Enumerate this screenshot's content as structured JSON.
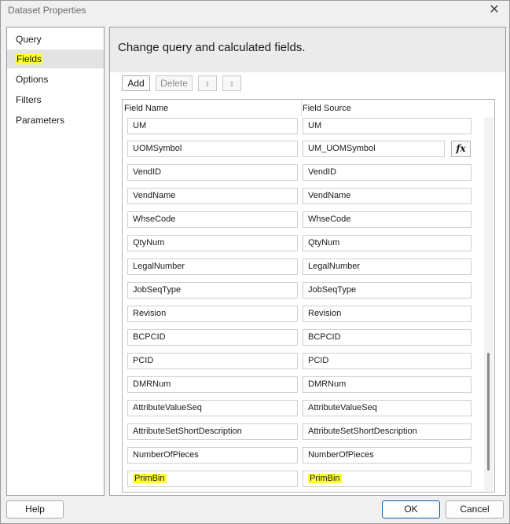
{
  "window": {
    "title": "Dataset Properties",
    "close_icon": "close-icon"
  },
  "nav": {
    "items": [
      {
        "label": "Query",
        "selected": false
      },
      {
        "label": "Fields",
        "selected": true
      },
      {
        "label": "Options",
        "selected": false
      },
      {
        "label": "Filters",
        "selected": false
      },
      {
        "label": "Parameters",
        "selected": false
      }
    ]
  },
  "content": {
    "heading": "Change query and calculated fields."
  },
  "toolbar": {
    "add_label": "Add",
    "delete_label": "Delete",
    "move_up_icon": "arrow-up-icon",
    "move_down_icon": "arrow-down-icon",
    "move_up_glyph": "⇧",
    "move_down_glyph": "⇩"
  },
  "grid": {
    "columns": [
      "Field Name",
      "Field Source"
    ],
    "rows": [
      {
        "name": "UM",
        "source": "UM"
      },
      {
        "name": "UOMSymbol",
        "source": "UM_UOMSymbol",
        "expression_button": "fx"
      },
      {
        "name": "VendID",
        "source": "VendID"
      },
      {
        "name": "VendName",
        "source": "VendName"
      },
      {
        "name": "WhseCode",
        "source": "WhseCode"
      },
      {
        "name": "QtyNum",
        "source": "QtyNum"
      },
      {
        "name": "LegalNumber",
        "source": "LegalNumber"
      },
      {
        "name": "JobSeqType",
        "source": "JobSeqType"
      },
      {
        "name": "Revision",
        "source": "Revision"
      },
      {
        "name": "BCPCID",
        "source": "BCPCID"
      },
      {
        "name": "PCID",
        "source": "PCID"
      },
      {
        "name": "DMRNum",
        "source": "DMRNum"
      },
      {
        "name": "AttributeValueSeq",
        "source": "AttributeValueSeq"
      },
      {
        "name": "AttributeSetShortDescription",
        "source": "AttributeSetShortDescription"
      },
      {
        "name": "NumberOfPieces",
        "source": "NumberOfPieces"
      },
      {
        "name": "PrimBin",
        "source": "PrimBin",
        "highlighted": true
      }
    ]
  },
  "footer": {
    "help_label": "Help",
    "ok_label": "OK",
    "cancel_label": "Cancel"
  },
  "colors": {
    "highlight": "#ffff33",
    "selected_nav_bg": "#e3e3e3",
    "ok_border": "#005fb8"
  }
}
